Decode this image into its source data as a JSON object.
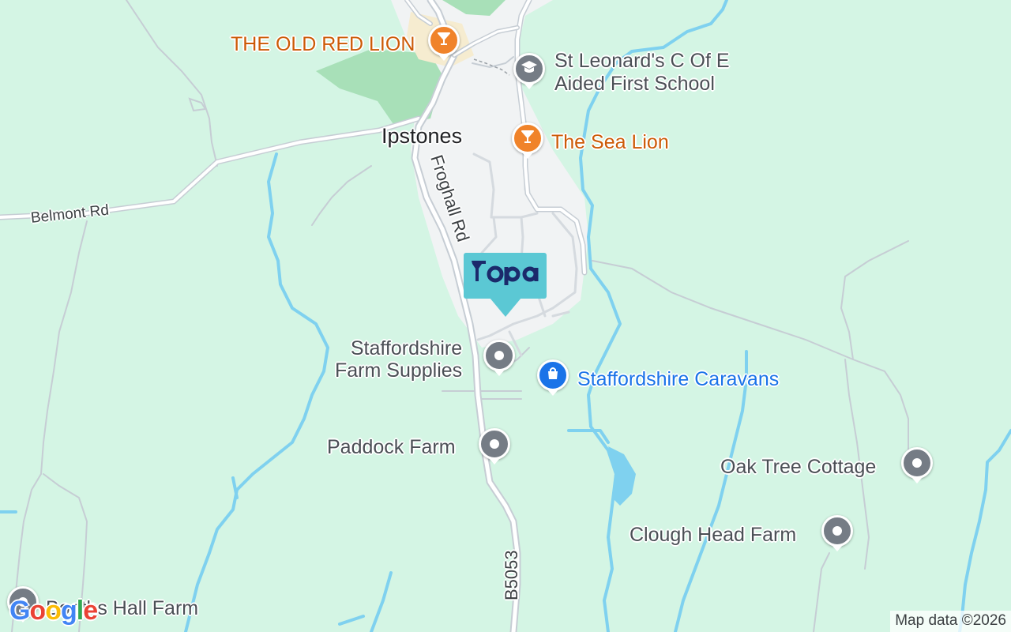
{
  "map": {
    "town": "Ipstones",
    "roads": {
      "froghall": "Froghall Rd",
      "belmont": "Belmont Rd",
      "b5053": "B5053"
    },
    "marker_brand": "Yopa",
    "google": "Google",
    "attribution": "Map data ©2026"
  },
  "pois": [
    {
      "name": "THE OLD RED LION",
      "icon": "cocktail-icon",
      "category": "bar"
    },
    {
      "name_line1": "St Leonard's C Of E",
      "name_line2": "Aided First School",
      "icon": "graduation-cap-icon",
      "category": "school"
    },
    {
      "name": "The Sea Lion",
      "icon": "cocktail-icon",
      "category": "bar"
    },
    {
      "name_line1": "Staffordshire",
      "name_line2": "Farm Supplies",
      "icon": "place-dot-icon",
      "category": "place"
    },
    {
      "name": "Staffordshire Caravans",
      "icon": "shopping-bag-icon",
      "category": "shopping"
    },
    {
      "name": "Paddock Farm",
      "icon": "place-dot-icon",
      "category": "place"
    },
    {
      "name": "Oak Tree Cottage",
      "icon": "place-dot-icon",
      "category": "place"
    },
    {
      "name": "Clough Head Farm",
      "icon": "place-dot-icon",
      "category": "place"
    },
    {
      "name": "Booths Hall Farm",
      "icon": "place-dot-icon",
      "category": "place"
    }
  ],
  "colors": {
    "land": "#d4f5e4",
    "park": "#a8e0b8",
    "urban": "#f1f3f4",
    "water": "#7fd1ef",
    "road": "#ffffff",
    "road_edge": "#c6cdd4",
    "poi_gray": "#757c85",
    "poi_orange": "#f0832a",
    "poi_blue": "#1a73e8",
    "yopa_bg": "#5bc8d4",
    "yopa_text": "#1b2a6b"
  }
}
